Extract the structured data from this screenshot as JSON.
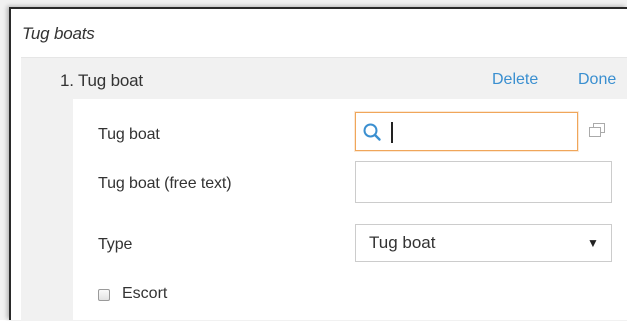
{
  "section": {
    "title": "Tug boats"
  },
  "item": {
    "header": "1. Tug boat",
    "delete_label": "Delete",
    "done_label": "Done"
  },
  "form": {
    "tug_boat_label": "Tug boat",
    "tug_boat_value": "",
    "free_text_label": "Tug boat (free text)",
    "free_text_value": "",
    "type_label": "Type",
    "type_selected": "Tug boat",
    "escort_label": "Escort",
    "escort_checked": false
  },
  "colors": {
    "link": "#3a8fd0",
    "focus_border": "#f0a65a",
    "panel_background": "#f1f1f1"
  },
  "icons": {
    "search": "search-icon",
    "copy": "copy-icon",
    "dropdown": "dropdown-arrow-icon"
  }
}
